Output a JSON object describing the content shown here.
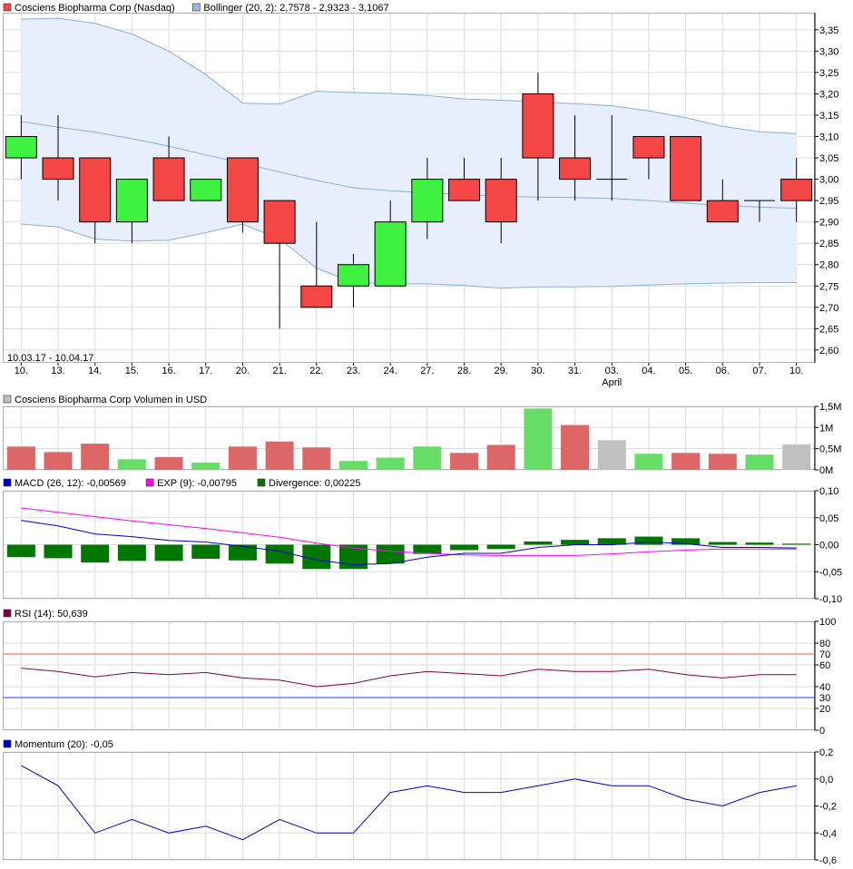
{
  "colors": {
    "up": "#3ff23f",
    "down": "#f54646",
    "vol_up": "#66dd66",
    "vol_down": "#dd6666",
    "vol_flat": "#c0c0c0",
    "bollinger_line": "#8aaede",
    "bollinger_fill": "#e8effc",
    "macd": "#0000cc",
    "exp": "#ff00ff",
    "divergence": "#007700",
    "rsi": "#880044",
    "rsi_upper": "#ff5555",
    "rsi_lower": "#3333ff",
    "momentum": "#0000cc",
    "grid": "#dcdcdc"
  },
  "chart_data": [
    {
      "type": "candlestick",
      "legend": [
        {
          "label": "Cosciens Biopharma Corp (Nasdaq)",
          "color": "#f54646"
        },
        {
          "label": "Bollinger (20, 2): 2,7578 - 2,9323 - 3,1067",
          "color": "#9fb8e6"
        }
      ],
      "date_range": "10.03.17 - 10.04.17",
      "x": [
        "10.",
        "13.",
        "14.",
        "15.",
        "16.",
        "17.",
        "20.",
        "21.",
        "22.",
        "23.",
        "24.",
        "27.",
        "28.",
        "29.",
        "30.",
        "31.",
        "03.",
        "04.",
        "05.",
        "06.",
        "07.",
        "10."
      ],
      "x_sublabel": {
        "index": 16,
        "text": "April"
      },
      "ylim": [
        2.57,
        3.39
      ],
      "y_ticks": [
        "2,60",
        "2,65",
        "2,70",
        "2,75",
        "2,80",
        "2,85",
        "2,90",
        "2,95",
        "3,00",
        "3,05",
        "3,10",
        "3,15",
        "3,20",
        "3,25",
        "3,30",
        "3,35"
      ],
      "candles": [
        {
          "o": 3.05,
          "h": 3.15,
          "l": 3.0,
          "c": 3.1
        },
        {
          "o": 3.05,
          "h": 3.15,
          "l": 2.95,
          "c": 3.0
        },
        {
          "o": 3.05,
          "h": 3.05,
          "l": 2.85,
          "c": 2.9
        },
        {
          "o": 2.9,
          "h": 3.0,
          "l": 2.85,
          "c": 3.0
        },
        {
          "o": 3.05,
          "h": 3.1,
          "l": 2.95,
          "c": 2.95
        },
        {
          "o": 2.95,
          "h": 3.0,
          "l": 2.95,
          "c": 3.0
        },
        {
          "o": 3.05,
          "h": 3.05,
          "l": 2.875,
          "c": 2.9
        },
        {
          "o": 2.95,
          "h": 2.95,
          "l": 2.65,
          "c": 2.85
        },
        {
          "o": 2.75,
          "h": 2.9,
          "l": 2.7,
          "c": 2.7
        },
        {
          "o": 2.75,
          "h": 2.825,
          "l": 2.7,
          "c": 2.8
        },
        {
          "o": 2.75,
          "h": 2.95,
          "l": 2.75,
          "c": 2.9
        },
        {
          "o": 2.9,
          "h": 3.05,
          "l": 2.86,
          "c": 3.0
        },
        {
          "o": 3.0,
          "h": 3.05,
          "l": 2.95,
          "c": 2.95
        },
        {
          "o": 3.0,
          "h": 3.05,
          "l": 2.85,
          "c": 2.9
        },
        {
          "o": 3.2,
          "h": 3.25,
          "l": 2.95,
          "c": 3.05
        },
        {
          "o": 3.05,
          "h": 3.15,
          "l": 2.95,
          "c": 3.0
        },
        {
          "o": 3.0,
          "h": 3.15,
          "l": 2.95,
          "c": 3.0
        },
        {
          "o": 3.1,
          "h": 3.1,
          "l": 3.0,
          "c": 3.05
        },
        {
          "o": 3.1,
          "h": 3.1,
          "l": 2.95,
          "c": 2.95
        },
        {
          "o": 2.95,
          "h": 3.0,
          "l": 2.9,
          "c": 2.9
        },
        {
          "o": 2.95,
          "h": 2.95,
          "l": 2.9,
          "c": 2.95
        },
        {
          "o": 3.0,
          "h": 3.05,
          "l": 2.9,
          "c": 2.95
        }
      ],
      "bollinger": {
        "upper": [
          3.375,
          3.377,
          3.365,
          3.34,
          3.3,
          3.245,
          3.178,
          3.176,
          3.206,
          3.203,
          3.201,
          3.196,
          3.188,
          3.185,
          3.181,
          3.177,
          3.172,
          3.16,
          3.144,
          3.124,
          3.111,
          3.107
        ],
        "middle": [
          3.135,
          3.122,
          3.11,
          3.095,
          3.077,
          3.057,
          3.038,
          3.017,
          2.997,
          2.98,
          2.973,
          2.968,
          2.964,
          2.96,
          2.958,
          2.957,
          2.955,
          2.95,
          2.944,
          2.938,
          2.935,
          2.932
        ],
        "lower": [
          2.895,
          2.888,
          2.86,
          2.855,
          2.857,
          2.875,
          2.895,
          2.86,
          2.792,
          2.758,
          2.755,
          2.755,
          2.751,
          2.745,
          2.748,
          2.748,
          2.749,
          2.752,
          2.755,
          2.757,
          2.758,
          2.758
        ]
      }
    },
    {
      "type": "bar",
      "legend": [
        {
          "label": "Cosciens Biopharma Corp Volumen in USD",
          "color": "#c0c0c0"
        }
      ],
      "ylim": [
        0,
        1.5
      ],
      "y_ticks": [
        "0M",
        "0,5M",
        "1M",
        "1,5M"
      ],
      "values": [
        0.55,
        0.42,
        0.62,
        0.25,
        0.3,
        0.17,
        0.55,
        0.67,
        0.53,
        0.21,
        0.29,
        0.55,
        0.4,
        0.59,
        1.45,
        1.06,
        0.7,
        0.38,
        0.4,
        0.38,
        0.36,
        0.6
      ],
      "dir": [
        "down",
        "down",
        "down",
        "up",
        "down",
        "up",
        "down",
        "down",
        "down",
        "up",
        "up",
        "up",
        "down",
        "down",
        "up",
        "down",
        "flat",
        "up",
        "down",
        "down",
        "up",
        "flat"
      ]
    },
    {
      "type": "line",
      "legend": [
        {
          "label": "MACD (26, 12): -0,00569",
          "color": "#0000cc"
        },
        {
          "label": "EXP (9): -0,00795",
          "color": "#ff00ff"
        },
        {
          "label": "Divergence: 0,00225",
          "color": "#007700"
        }
      ],
      "ylim": [
        -0.1,
        0.1
      ],
      "y_ticks": [
        "-0,10",
        "-0,05",
        "0,00",
        "0,05",
        "0,10"
      ],
      "macd": [
        0.045,
        0.035,
        0.02,
        0.015,
        0.008,
        0.005,
        -0.003,
        -0.012,
        -0.028,
        -0.037,
        -0.035,
        -0.023,
        -0.016,
        -0.016,
        -0.005,
        0.0,
        0.0,
        0.005,
        0.002,
        -0.005,
        -0.005,
        -0.006
      ],
      "exp": [
        0.068,
        0.06,
        0.052,
        0.044,
        0.037,
        0.03,
        0.022,
        0.014,
        0.003,
        -0.006,
        -0.012,
        -0.016,
        -0.019,
        -0.02,
        -0.02,
        -0.02,
        -0.017,
        -0.013,
        -0.01,
        -0.008,
        -0.008,
        -0.008
      ],
      "divergence": [
        -0.023,
        -0.025,
        -0.033,
        -0.03,
        -0.03,
        -0.026,
        -0.029,
        -0.035,
        -0.045,
        -0.045,
        -0.035,
        -0.017,
        -0.01,
        -0.008,
        0.006,
        0.009,
        0.012,
        0.015,
        0.012,
        0.005,
        0.004,
        0.002
      ]
    },
    {
      "type": "line",
      "legend": [
        {
          "label": "RSI (14): 50,639",
          "color": "#880044"
        }
      ],
      "ylim": [
        0,
        100
      ],
      "y_ticks": [
        "0",
        "20",
        "40",
        "60",
        "80",
        "100"
      ],
      "reference_lines": [
        {
          "value": 70,
          "label": "70",
          "color": "#ff5555"
        },
        {
          "value": 30,
          "label": "30",
          "color": "#3333ff"
        }
      ],
      "values": [
        57,
        54,
        49,
        53,
        51,
        53,
        48,
        46,
        40,
        43,
        50,
        54,
        52,
        50,
        56,
        54,
        54,
        56,
        51,
        48,
        51,
        51
      ]
    },
    {
      "type": "line",
      "legend": [
        {
          "label": "Momentum (20): -0,05",
          "color": "#0000cc"
        }
      ],
      "ylim": [
        -0.6,
        0.2
      ],
      "y_ticks": [
        "-0,6",
        "-0,4",
        "-0,2",
        "0,0",
        "0,2"
      ],
      "values": [
        0.1,
        -0.05,
        -0.4,
        -0.3,
        -0.4,
        -0.35,
        -0.45,
        -0.3,
        -0.4,
        -0.4,
        -0.1,
        -0.05,
        -0.1,
        -0.1,
        -0.05,
        0.0,
        -0.05,
        -0.05,
        -0.15,
        -0.2,
        -0.1,
        -0.05
      ]
    }
  ]
}
